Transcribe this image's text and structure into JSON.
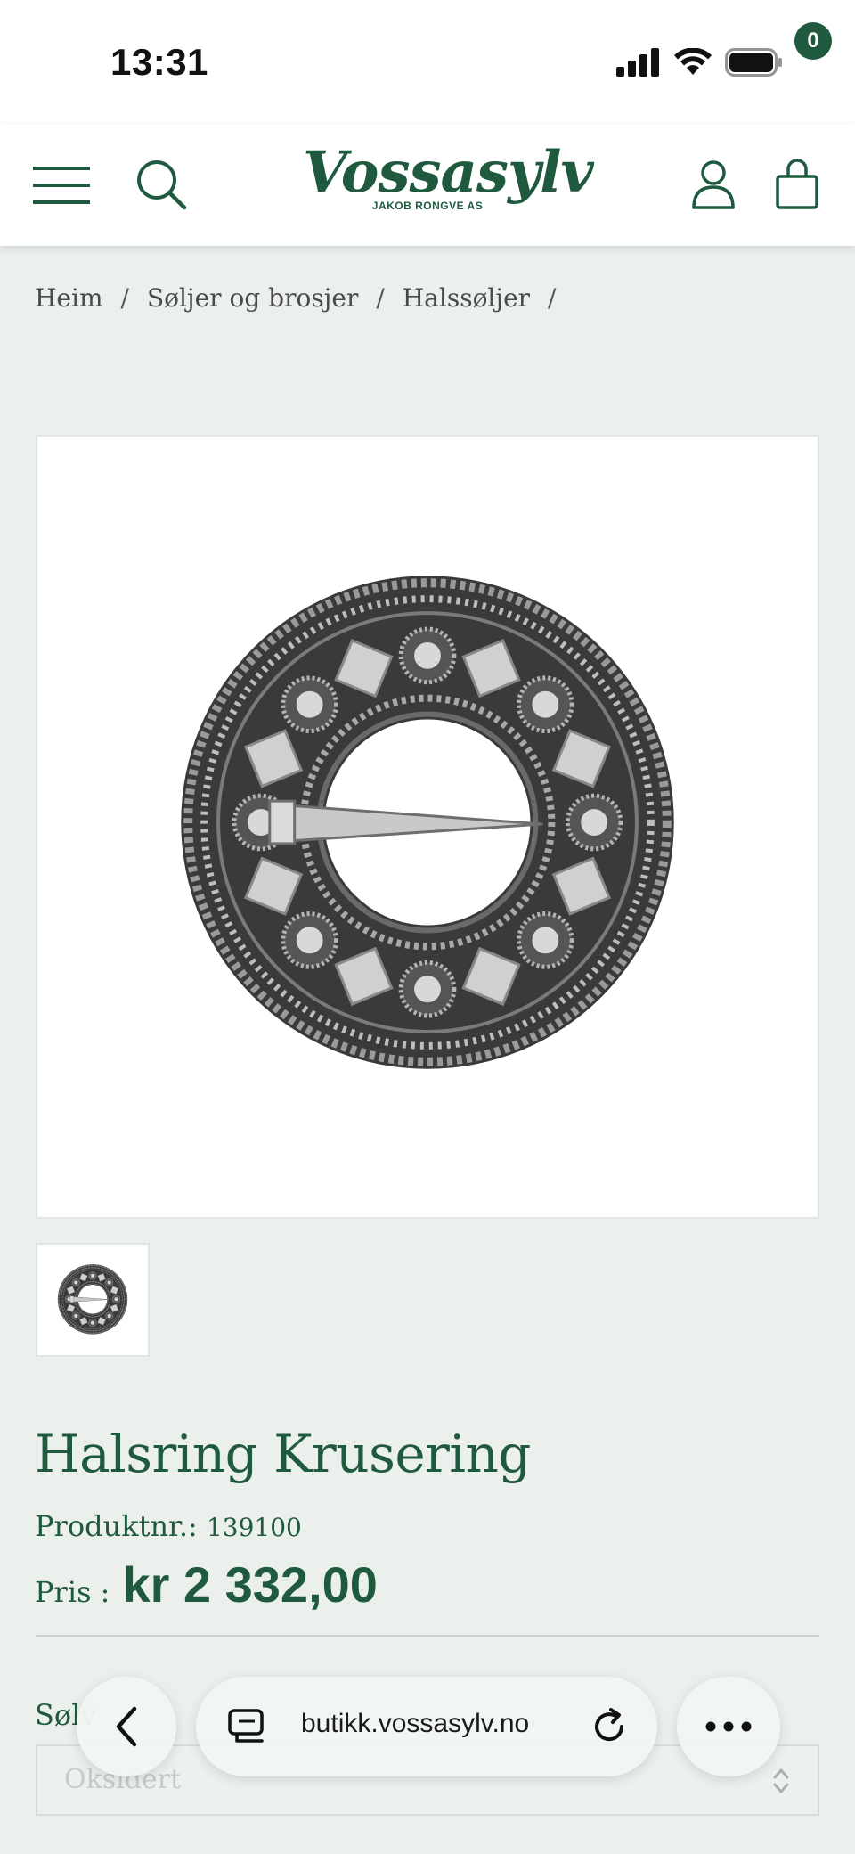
{
  "status_bar": {
    "time": "13:31"
  },
  "header": {
    "logo_text": "Vossasylv",
    "logo_subtext": "JAKOB RONGVE AS",
    "cart_count": "0"
  },
  "breadcrumb": {
    "items": [
      "Heim",
      "Søljer og brosjer",
      "Halssøljer"
    ],
    "separator": "/"
  },
  "product": {
    "title": "Halsring Krusering",
    "sku_label": "Produktnr.:",
    "sku_value": "139100",
    "price_label": "Pris :",
    "price_value": "kr 2 332,00",
    "variant_label": "Sølv",
    "variant_selected": "Oksidert"
  },
  "browser": {
    "url": "butikk.vossasylv.no"
  },
  "colors": {
    "brand_green": "#1f5a3f",
    "page_background": "#ebf0ec"
  }
}
